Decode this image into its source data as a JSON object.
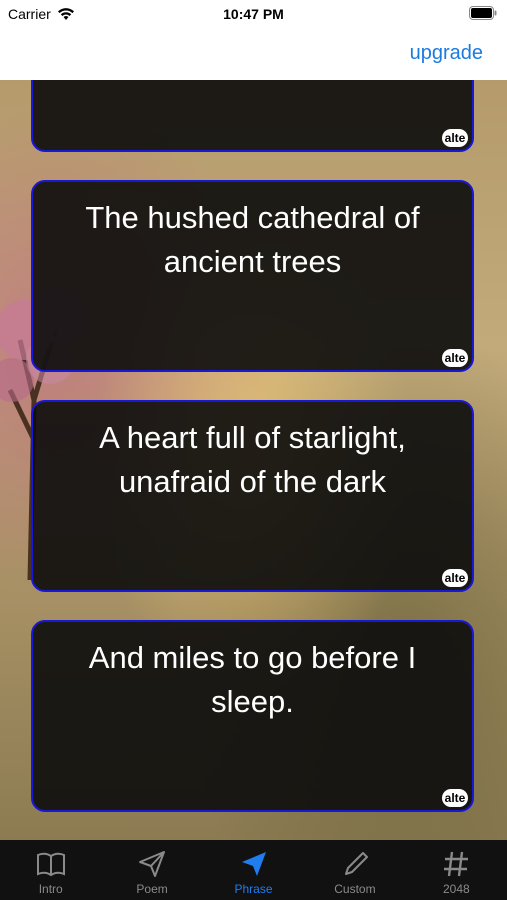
{
  "status_bar": {
    "carrier": "Carrier",
    "time": "10:47 PM"
  },
  "nav": {
    "upgrade_label": "upgrade"
  },
  "cards": [
    {
      "text": "",
      "alt_label": "alte"
    },
    {
      "text": "The hushed cathedral of ancient trees",
      "alt_label": "alte"
    },
    {
      "text": "A heart full of starlight, unafraid of the dark",
      "alt_label": "alte"
    },
    {
      "text": "And miles to go before I sleep.",
      "alt_label": "alte"
    }
  ],
  "tabs": [
    {
      "label": "Intro",
      "icon": "book-icon",
      "active": false
    },
    {
      "label": "Poem",
      "icon": "paper-plane-outline-icon",
      "active": false
    },
    {
      "label": "Phrase",
      "icon": "paper-plane-filled-icon",
      "active": true
    },
    {
      "label": "Custom",
      "icon": "pencil-icon",
      "active": false
    },
    {
      "label": "2048",
      "icon": "hash-icon",
      "active": false
    }
  ],
  "colors": {
    "accent": "#1f7df0",
    "link": "#1a7be0",
    "card_border": "#1818d8",
    "tab_bar_bg": "#111111"
  }
}
